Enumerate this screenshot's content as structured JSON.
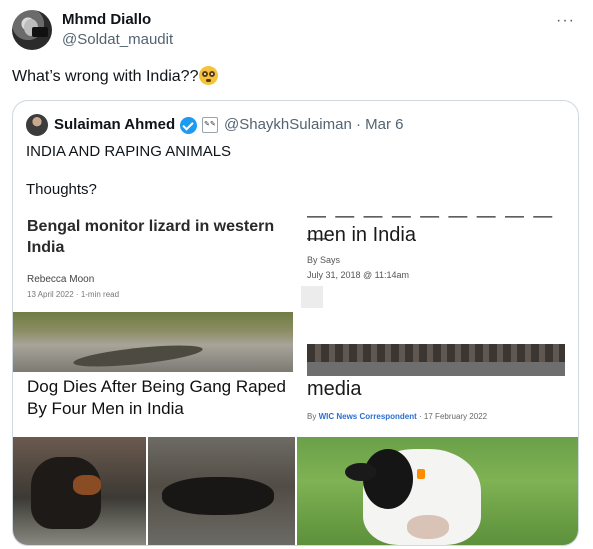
{
  "tweet": {
    "author_name": "Mhmd Diallo",
    "author_handle": "@Soldat_maudit",
    "more_icon": "more-icon",
    "text": "What’s wrong with India??",
    "emoji": "flushed-face-icon"
  },
  "quoted": {
    "author_name": "Sulaiman Ahmed",
    "verified_icon": "verified-badge-icon",
    "affiliate_icon": "affiliate-badge-icon",
    "affiliate_text": "✎✎",
    "meta": "@ShaykhSulaiman · Mar 6",
    "text_line1": "INDIA AND RAPING ANIMALS",
    "text_line2": "Thoughts?",
    "media": {
      "card1": {
        "headline": "Bengal monitor lizard in western India",
        "byline": "Rebecca Moon",
        "date": "13 April 2022 · 1-min read",
        "headline2": "Dog Dies After Being Gang Raped By Four Men in India"
      },
      "card2": {
        "headline": "men in India",
        "by": "By Says",
        "time": "July 31, 2018 @ 11:14am",
        "headline2": "media",
        "credit_prefix": "By",
        "credit_author": "WIC News Correspondent",
        "credit_date": "· 17 February 2022"
      }
    }
  },
  "colors": {
    "text_primary": "#0f1419",
    "text_secondary": "#536471",
    "border": "#cfd9de",
    "verified_blue": "#1d9bf0"
  }
}
